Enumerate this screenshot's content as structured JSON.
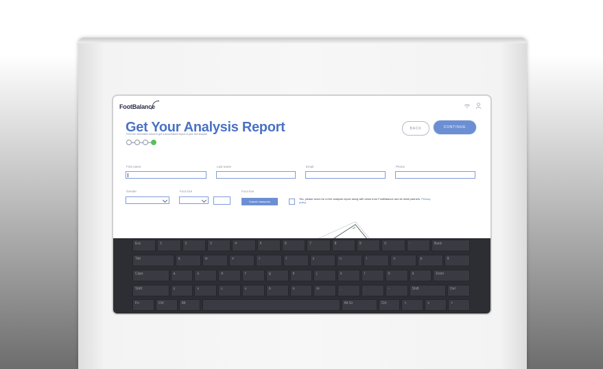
{
  "app": {
    "logo_text": "FootBalance",
    "title": "Get Your Analysis Report",
    "subtitle": "Fill in the information below to get a personalized report of your foot analysis",
    "steps_total": 4,
    "steps_active": 4
  },
  "header_icons": {
    "wifi": "wifi-icon",
    "user": "user-icon"
  },
  "buttons": {
    "back": "BACK",
    "continue": "CONTINUE",
    "submit": "Submit measures"
  },
  "form": {
    "first_name": {
      "label": "First name",
      "value": ""
    },
    "last_name": {
      "label": "Last name",
      "value": ""
    },
    "email": {
      "label": "Email",
      "value": ""
    },
    "phone": {
      "label": "Phone",
      "value": ""
    },
    "gender": {
      "label": "Gender",
      "value": ""
    },
    "foot_size": {
      "label": "Foot size",
      "value": ""
    },
    "foot_size_number": {
      "value": ""
    },
    "feet_size": {
      "label": "Foot size"
    }
  },
  "consent": {
    "text": "Yes, please send me a free analysis report along with news from FootBalance and its retail partners.",
    "link": "Privacy policy"
  },
  "keyboard": {
    "row1": [
      "Esc",
      "1",
      "2",
      "3",
      "4",
      "5",
      "6",
      "7",
      "8",
      "9",
      "0",
      "-",
      "Back"
    ],
    "row2": [
      "Tab",
      "q",
      "w",
      "e",
      "r",
      "t",
      "y",
      "u",
      "i",
      "o",
      "p",
      "å"
    ],
    "row3": [
      "Caps",
      "a",
      "s",
      "d",
      "f",
      "g",
      "h",
      "j",
      "k",
      "l",
      "ö",
      "ä",
      "Enter"
    ],
    "row4": [
      "Shift",
      "z",
      "x",
      "c",
      "v",
      "b",
      "n",
      "m",
      ",",
      ".",
      "-",
      "Shift",
      "Del"
    ],
    "row5": [
      "Fn",
      "Ctrl",
      "Alt",
      "",
      "Alt Gr",
      "Ctrl",
      "<",
      "v",
      ">"
    ]
  },
  "colors": {
    "accent": "#4a72c4",
    "button_primary": "#6c8fd3",
    "step_active": "#59c05a",
    "keyboard_bg": "#2d2e34"
  }
}
